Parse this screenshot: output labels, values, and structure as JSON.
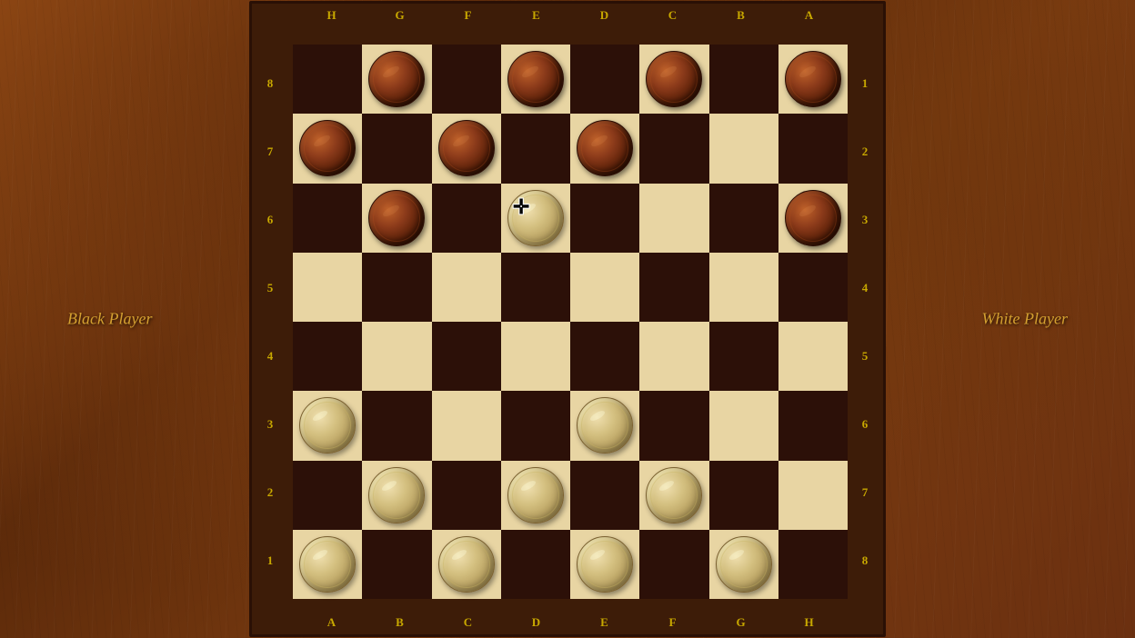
{
  "players": {
    "black": "Black Player",
    "white": "White Player"
  },
  "board": {
    "colLabelsTop": [
      "H",
      "G",
      "F",
      "E",
      "D",
      "C",
      "B",
      "A"
    ],
    "colLabelsBottom": [
      "A",
      "B",
      "C",
      "D",
      "E",
      "F",
      "G",
      "H"
    ],
    "rowLabelsLeft": [
      "8",
      "7",
      "6",
      "5",
      "4",
      "3",
      "2",
      "1"
    ],
    "rowLabelsRight": [
      "1",
      "2",
      "3",
      "4",
      "5",
      "6",
      "7",
      "8"
    ]
  },
  "pieces": {
    "black_positions": [
      [
        0,
        1
      ],
      [
        0,
        3
      ],
      [
        0,
        5
      ],
      [
        0,
        7
      ],
      [
        1,
        0
      ],
      [
        1,
        2
      ],
      [
        1,
        4
      ],
      [
        2,
        1
      ],
      [
        2,
        7
      ]
    ],
    "white_positions": [
      [
        5,
        0
      ],
      [
        5,
        4
      ],
      [
        6,
        1
      ],
      [
        6,
        3
      ],
      [
        6,
        5
      ],
      [
        7,
        0
      ],
      [
        7,
        2
      ],
      [
        7,
        4
      ],
      [
        7,
        6
      ]
    ],
    "dragging": [
      2,
      3
    ]
  }
}
